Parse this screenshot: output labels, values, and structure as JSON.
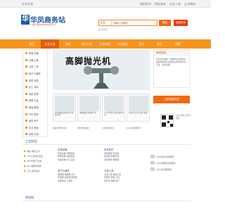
{
  "topbar": {
    "left_text": "企业名录",
    "links": [
      "商机发布",
      "供应发布",
      "企业入驻",
      "企业建站"
    ]
  },
  "logo": {
    "mark": "华",
    "name": "华凤商务站",
    "slogan": "一站打造您的B2B商务平台"
  },
  "search": {
    "category": "企业",
    "placeholder": "请输入关键字",
    "button": "搜索",
    "free_button": "免费发布",
    "hot": "热门搜索："
  },
  "nav": {
    "items": [
      "首页",
      "企业大全",
      "商机",
      "供应产品",
      "企业新闻",
      "产品报价",
      "资讯",
      "展会",
      "招聘"
    ],
    "active_index": 1
  },
  "categories": [
    "机械 设备",
    "仪器 仪表",
    "五金 工具",
    "电子 元器件",
    "安防 消防",
    "化工 涂料",
    "纺织 皮革",
    "家居 礼品",
    "服装 鞋帽",
    "汽车 配件",
    "建材 房产",
    "农业 食品",
    "其他 分类"
  ],
  "banner": {
    "title": "高脚抛光机"
  },
  "thumbs": [
    {
      "caption": "供应电镀设备纯水机 批发价格"
    },
    {
      "caption": "电线电缆高效拉丝 机"
    },
    {
      "caption": "1:1型平板全自动 数控车床"
    },
    {
      "caption": "高档实木茶台茶桌 批发"
    }
  ],
  "small_links": [
    "供应大理石切割",
    "供应导热油炉",
    "全自动包装机",
    "2012款机床配件"
  ],
  "right_box": {
    "title": "使用指南",
    "body": "华凤商务站是一家面向企业提供免费发布供求信息和企业展示的B2B平台，欢迎注册。"
  },
  "signin_button": "立即免费注册",
  "qr_text": "扫描二维码 访问手机版",
  "section1": {
    "title": "工业制品"
  },
  "list1": [
    "电钻 电动工具",
    "1234 自动化设备",
    "LED节能灯 批发",
    "PLC 编程控制器",
    "工业 焊接设备"
  ],
  "catblocks": [
    {
      "heading": "机械设备",
      "lines": [
        "包装机械 印刷机械",
        "塑料机械 纺织机械",
        "食品机械 化工设备"
      ]
    },
    {
      "heading": "电子元器件",
      "lines": [
        "电容器 电阻器 芯片",
        "传感器 连接器 继电器",
        "电源模块 二极管"
      ]
    },
    {
      "heading": "安全防护",
      "lines": [
        "消防器材 安全帽",
        "防护服 劳保手套",
        "监控器材 报警器"
      ]
    },
    {
      "heading": "五金工具",
      "lines": [
        "手动工具 电动工具",
        "紧固件 量具 刃具",
        "密封件 轴承 阀门"
      ]
    }
  ],
  "right_list": [
    "2019款ZK机床配件",
    "2013款数控车床配件",
    "2014款平面磨床"
  ],
  "section2": {
    "title": "原材料"
  }
}
